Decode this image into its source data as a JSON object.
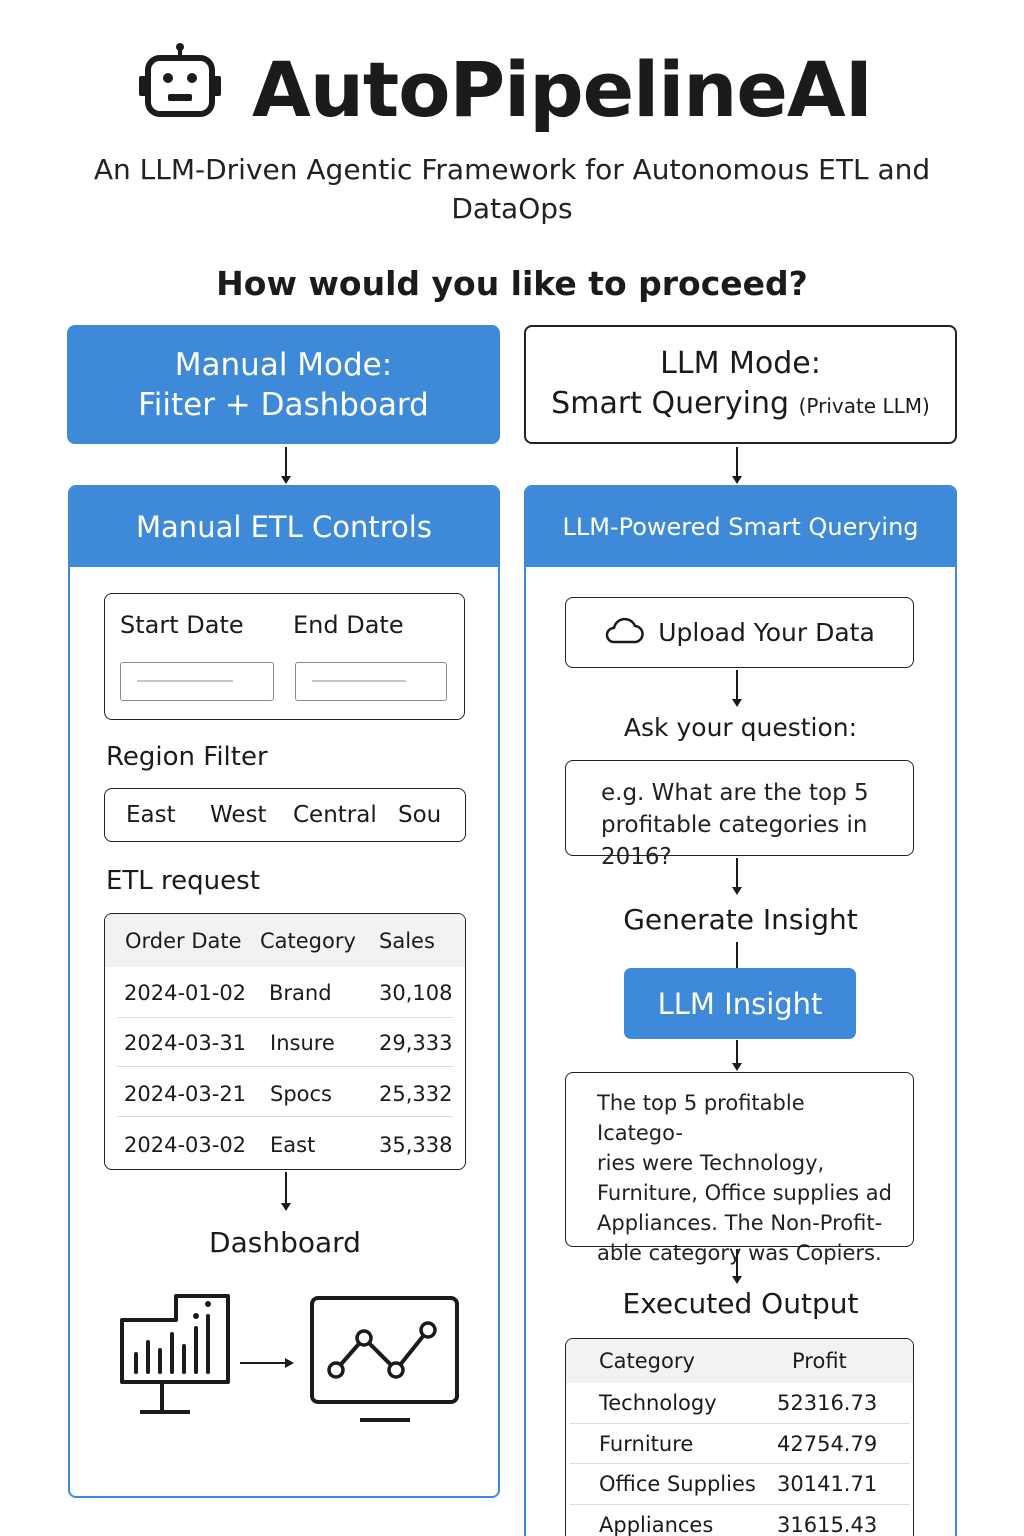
{
  "header": {
    "app_title": "AutoPipelineAI",
    "logo_icon": "robot-icon",
    "subtitle_line1": "An LLM-Driven Agentic Framework for Autonomous ETL and",
    "subtitle_line2": "DataOps",
    "question": "How would you like to proceed?"
  },
  "modes": {
    "manual": {
      "line1": "Manual Mode:",
      "line2": "Fiiter + Dashboard"
    },
    "llm": {
      "line1": "LLM Mode:",
      "line2": "Smart Querying",
      "line2_small": "(Private LLM)"
    }
  },
  "manual_panel": {
    "title": "Manual ETL Controls",
    "start_date_label": "Start Date",
    "end_date_label": "End Date",
    "start_date_value": "",
    "end_date_value": "",
    "region_filter_label": "Region Filter",
    "regions": [
      "East",
      "West",
      "Central",
      "Sou"
    ],
    "etl_request_label": "ETL request",
    "table": {
      "columns": [
        "Order Date",
        "Category",
        "Sales"
      ],
      "rows": [
        [
          "2024-01-02",
          "Brand",
          "30,108"
        ],
        [
          "2024-03-31",
          "Insure",
          "29,333"
        ],
        [
          "2024-03-21",
          "Spocs",
          "25,332"
        ],
        [
          "2024-03-02",
          "East",
          "35,338"
        ]
      ]
    },
    "dashboard_label": "Dashboard",
    "dashboard_icons": [
      "bar-chart-monitor-icon",
      "line-chart-monitor-icon"
    ]
  },
  "llm_panel": {
    "title": "LLM-Powered Smart Querying",
    "upload_label": "Upload Your Data",
    "upload_icon": "cloud-icon",
    "ask_label": "Ask your question:",
    "question_line1": "e.g. What are the top 5",
    "question_line2": "profitable categories in 2016?",
    "generate_label": "Generate Insight",
    "insight_button": "LLM Insight",
    "insight_lines": [
      "The top 5 profitable Icatego-",
      "ries were Technology,",
      "Furniture, Office supplies ad",
      "Appliances. The Non-Profit-",
      "able category was Copiers."
    ],
    "executed_label": "Executed Output",
    "output_table": {
      "columns": [
        "Category",
        "Profit"
      ],
      "rows": [
        [
          "Technology",
          "52316.73"
        ],
        [
          "Furniture",
          "42754.79"
        ],
        [
          "Office Supplies",
          "30141.71"
        ],
        [
          "Appliances",
          "31615.43"
        ]
      ]
    }
  },
  "colors": {
    "accent": "#3e8ad8",
    "text": "#1b1b1b",
    "border": "#222222",
    "table_header_bg": "#f2f2f2"
  }
}
